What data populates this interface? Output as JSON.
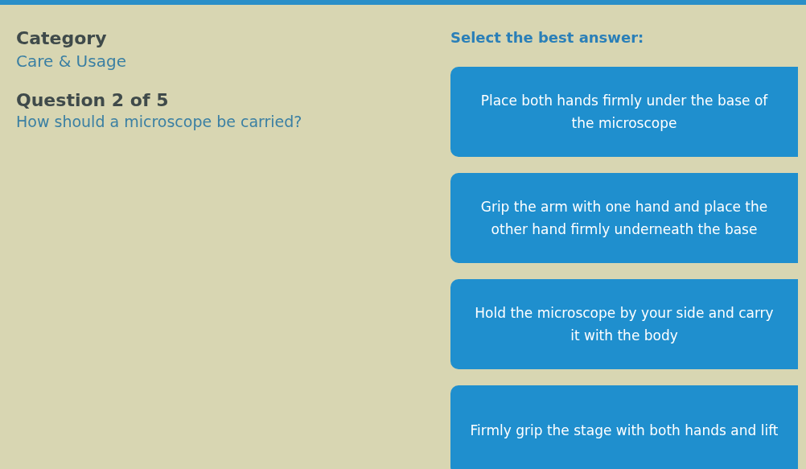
{
  "category": {
    "label": "Category",
    "value": "Care & Usage"
  },
  "question": {
    "label": "Question 2 of 5",
    "text": "How should a microscope be carried?"
  },
  "prompt": "Select the best answer:",
  "answers": [
    {
      "text": "Place both hands firmly under the base of the microscope"
    },
    {
      "text": "Grip the arm with one hand and place the other hand firmly underneath the base"
    },
    {
      "text": "Hold the microscope by your side and carry it with the body"
    },
    {
      "text": "Firmly grip the stage with both hands and lift"
    }
  ]
}
